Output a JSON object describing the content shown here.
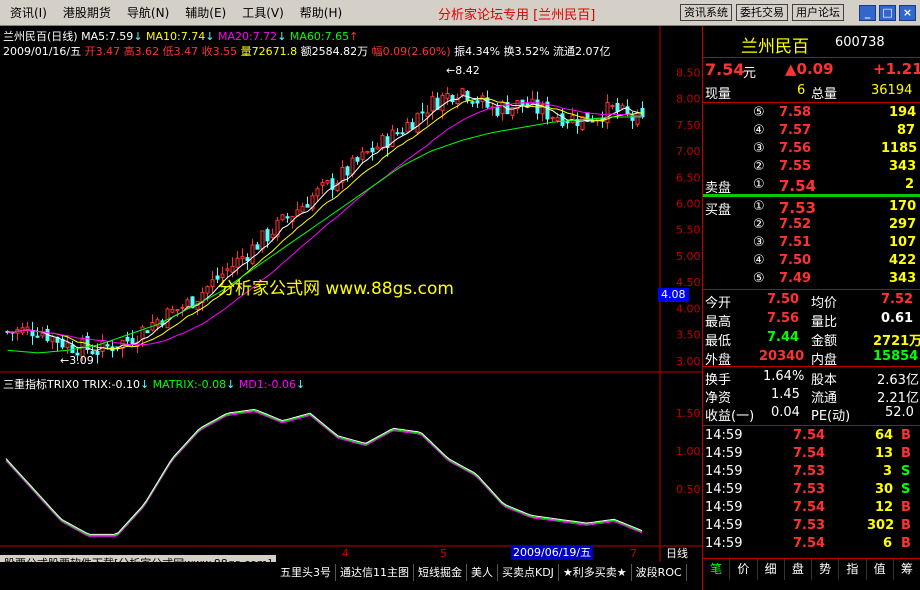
{
  "menu": [
    "资讯(I)",
    "港股期货",
    "导航(N)",
    "辅助(E)",
    "工具(V)",
    "帮助(H)"
  ],
  "window_title": "分析家论坛专用 [兰州民百]",
  "top_buttons": [
    "资讯系统",
    "委托交易",
    "用户论坛"
  ],
  "stock": {
    "name": "兰州民百",
    "code": "600738"
  },
  "chart_header": {
    "title": "兰州民百(日线)",
    "ma5": "MA5:7.59",
    "ma10": "MA10:7.74",
    "ma20": "MA20:7.72",
    "ma60": "MA60:7.65"
  },
  "info_line": {
    "date": "2009/01/16/五",
    "open": "开3.47",
    "high": "高3.62",
    "low": "低3.47",
    "close": "收3.55",
    "vol": "量72671.8",
    "amount": "额2584.82万",
    "change": "幅0.09(2.60%)",
    "amp": "振4.34%",
    "turnover": "换3.52%",
    "float": "流通2.07亿"
  },
  "y_axis_main": [
    "8.50",
    "8.00",
    "7.50",
    "7.00",
    "6.50",
    "6.00",
    "5.50",
    "5.00",
    "4.50",
    "4.00",
    "3.50",
    "3.00"
  ],
  "current_price_tag": "4.08",
  "high_label": "8.42",
  "low_label": "3.09",
  "watermark": "分析家公式网 www.88gs.com",
  "indicator": {
    "title": "三重指标TRIX0",
    "trix": "TRIX:-0.10",
    "matrix": "MATRIX:-0.08",
    "md1": "MD1:-0.06",
    "y_axis": [
      "1.50",
      "1.00",
      "0.50"
    ]
  },
  "x_axis": [
    "4",
    "5",
    "7"
  ],
  "x_cursor_date": "2009/06/19/五",
  "period_label": "日线",
  "footer_text": "股票公式股票软件下载[分析家公式网www.88gs.com]",
  "bottom_tabs": [
    "五里头3号",
    "通达信11主图",
    "短线掘金",
    "美人",
    "买卖点KDJ",
    "★利多买卖★",
    "波段ROC"
  ],
  "colors": {
    "up": "#ff3232",
    "down": "#54ffff",
    "ma5": "#ffffff",
    "ma10": "#ffff00",
    "ma20": "#ff00ff",
    "ma60": "#00ff00"
  },
  "right": {
    "price": "7.54",
    "price_unit": "元",
    "change": "▲0.09",
    "change2": "+1.21",
    "now_vol_label": "现量",
    "now_vol": "6",
    "total_vol_label": "总量",
    "total_vol": "36194",
    "sells": [
      {
        "lvl": "⑤",
        "price": "7.58",
        "vol": "194"
      },
      {
        "lvl": "④",
        "price": "7.57",
        "vol": "87"
      },
      {
        "lvl": "③",
        "price": "7.56",
        "vol": "1185"
      },
      {
        "lvl": "②",
        "price": "7.55",
        "vol": "343"
      },
      {
        "lvl": "①",
        "price": "7.54",
        "vol": "2"
      }
    ],
    "sell_label": "卖盘",
    "buy_label": "买盘",
    "buys": [
      {
        "lvl": "①",
        "price": "7.53",
        "vol": "170"
      },
      {
        "lvl": "②",
        "price": "7.52",
        "vol": "297"
      },
      {
        "lvl": "③",
        "price": "7.51",
        "vol": "107"
      },
      {
        "lvl": "④",
        "price": "7.50",
        "vol": "422"
      },
      {
        "lvl": "⑤",
        "price": "7.49",
        "vol": "343"
      }
    ],
    "stats": [
      {
        "l1": "今开",
        "v1": "7.50",
        "l2": "均价",
        "v2": "7.52"
      },
      {
        "l1": "最高",
        "v1": "7.56",
        "l2": "量比",
        "v2": "0.61"
      },
      {
        "l1": "最低",
        "v1": "7.44",
        "l2": "金额",
        "v2": "2721万"
      },
      {
        "l1": "外盘",
        "v1": "20340",
        "l2": "内盘",
        "v2": "15854"
      }
    ],
    "fin": [
      {
        "l1": "换手",
        "v1": "1.64%",
        "l2": "股本",
        "v2": "2.63亿"
      },
      {
        "l1": "净资",
        "v1": "1.45",
        "l2": "流通",
        "v2": "2.21亿"
      },
      {
        "l1": "收益(一)",
        "v1": "0.04",
        "l2": "PE(动)",
        "v2": "52.0"
      }
    ],
    "ticks": [
      {
        "t": "14:59",
        "p": "7.54",
        "v": "64",
        "s": "B"
      },
      {
        "t": "14:59",
        "p": "7.54",
        "v": "13",
        "s": "B"
      },
      {
        "t": "14:59",
        "p": "7.53",
        "v": "3",
        "s": "S"
      },
      {
        "t": "14:59",
        "p": "7.53",
        "v": "30",
        "s": "S"
      },
      {
        "t": "14:59",
        "p": "7.54",
        "v": "12",
        "s": "B"
      },
      {
        "t": "14:59",
        "p": "7.53",
        "v": "302",
        "s": "B"
      },
      {
        "t": "14:59",
        "p": "7.54",
        "v": "6",
        "s": "B"
      }
    ],
    "tabs": [
      "笔",
      "价",
      "细",
      "盘",
      "势",
      "指",
      "值",
      "筹"
    ]
  },
  "chart_data": {
    "type": "line",
    "title": "兰州民百(日线)",
    "ylim": [
      2.9,
      8.7
    ],
    "price_trend_close": [
      3.55,
      3.6,
      3.3,
      3.2,
      3.4,
      3.8,
      4.1,
      4.6,
      5.1,
      5.6,
      6.1,
      6.5,
      7.0,
      7.4,
      7.9,
      8.2,
      7.8,
      7.9,
      7.7,
      7.6,
      7.8,
      7.54
    ],
    "ma60_trend": [
      3.2,
      3.15,
      3.2,
      3.3,
      3.5,
      3.7,
      4.0,
      4.3,
      4.7,
      5.1,
      5.5,
      5.9,
      6.3,
      6.7,
      7.0,
      7.2,
      7.35,
      7.45,
      7.55,
      7.6,
      7.65,
      7.65
    ],
    "trix_ylim": [
      -0.2,
      1.7
    ],
    "trix": [
      0.9,
      0.5,
      0.1,
      -0.1,
      -0.1,
      0.3,
      0.9,
      1.3,
      1.5,
      1.55,
      1.4,
      1.5,
      1.2,
      1.1,
      1.3,
      1.25,
      0.9,
      0.7,
      0.3,
      0.15,
      0.1,
      0.05,
      0.1,
      -0.05
    ]
  }
}
